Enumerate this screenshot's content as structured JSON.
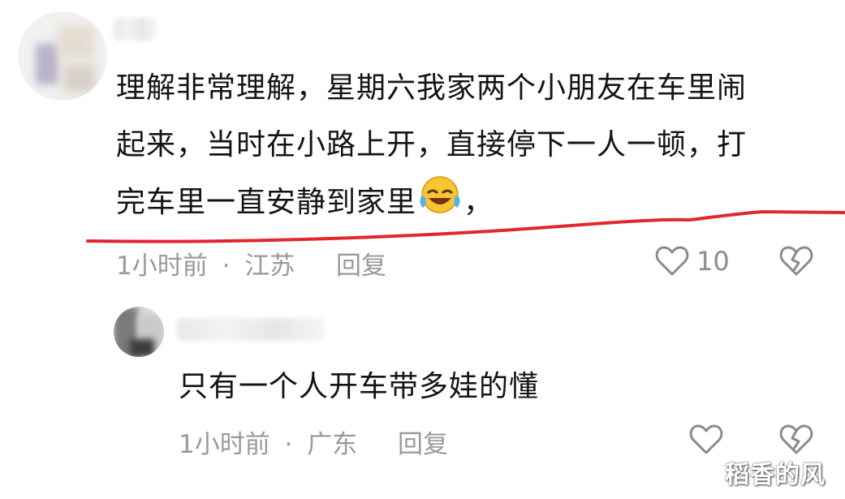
{
  "comments": [
    {
      "text_line1": "理解非常理解，星期六我家两个小朋友在车里闹",
      "text_line2": "起来，当时在小路上开，直接停下一人一顿，打",
      "text_line3": "完车里一直安静到家里",
      "text_line3_tail": "，",
      "emoji": "rofl-emoji",
      "time": "1小时前",
      "separator": "·",
      "location": "江苏",
      "reply_label": "回复",
      "like_count": "10",
      "like_icon": "heart-outline-icon",
      "dislike_icon": "broken-heart-icon"
    },
    {
      "text": "只有一个人开车带多娃的懂",
      "time": "1小时前",
      "separator": "·",
      "location": "广东",
      "reply_label": "回复",
      "like_icon": "heart-outline-icon",
      "dislike_icon": "broken-heart-icon"
    }
  ],
  "watermark": "稻香的风",
  "annotation_color": "#e0282c"
}
